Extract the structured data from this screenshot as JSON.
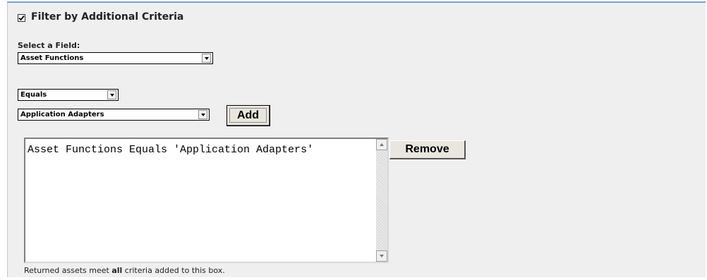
{
  "filter": {
    "checkbox_checked": true,
    "title": "Filter by Additional Criteria",
    "field_label": "Select a Field:",
    "field_value": "Asset Functions",
    "operator_value": "Equals",
    "criteria_value": "Application Adapters",
    "add_label": "Add",
    "remove_label": "Remove",
    "criteria_entries": [
      "Asset Functions Equals 'Application Adapters'"
    ],
    "footnote_prefix": "Returned assets meet ",
    "footnote_emphasis": "all",
    "footnote_suffix": " criteria added to this box."
  },
  "icons": {
    "checkbox": "checkmark-icon",
    "dropdown": "chevron-down-icon",
    "scroll_up": "scroll-up-arrow-icon",
    "scroll_down": "scroll-down-arrow-icon"
  },
  "colors": {
    "panel_background": "#efefef",
    "panel_top_border": "#7aa0c8",
    "button_face": "#e8e6df"
  }
}
